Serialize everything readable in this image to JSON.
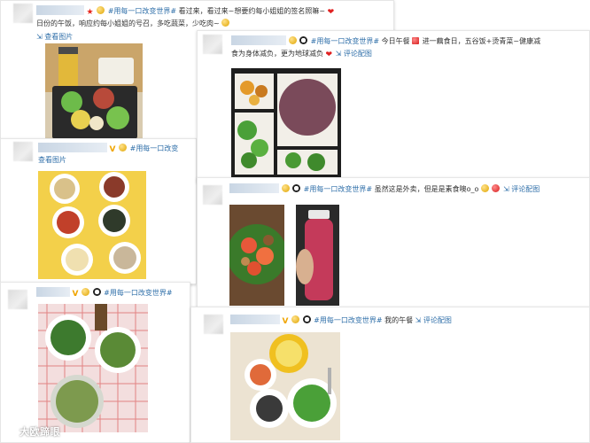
{
  "posts": [
    {
      "tag": "#用每一口改变世界#",
      "text_line1": "看过来，看过来~想要约每小姐姐的签名照嘛~",
      "text_line2": "日份的午饭，响应约每小姐姐的号召，多吃蔬菜，少吃肉~",
      "link": "查看图片"
    },
    {
      "link": "查看图片",
      "tag": "#用每一口改变"
    },
    {
      "tag": "#用每一口改变世界#"
    },
    {
      "tag": "#用每一口改变世界#",
      "text_line1": "今日午餐",
      "text_line1b": "进一藕食日，五谷饭+烫青菜~健康减",
      "text_line2": "食为身体减负，更为地球减负",
      "link": "评论配图"
    },
    {
      "tag": "#用每一口改变世界#",
      "text": "虽然这是外卖，但是是素食噢o_o",
      "link": "评论配图"
    },
    {
      "tag": "#用每一口改变世界#",
      "text": "我的午餐",
      "link": "评论配图"
    }
  ],
  "watermark": {
    "text": "大欧蹄眼"
  },
  "icons": [
    "star-icon",
    "emoji-icon",
    "heart-icon",
    "panda-icon",
    "v-badge-icon",
    "link-icon"
  ],
  "colors": {
    "link": "#2f6fa9",
    "heart": "#e02020",
    "badge": "#f0a500"
  }
}
